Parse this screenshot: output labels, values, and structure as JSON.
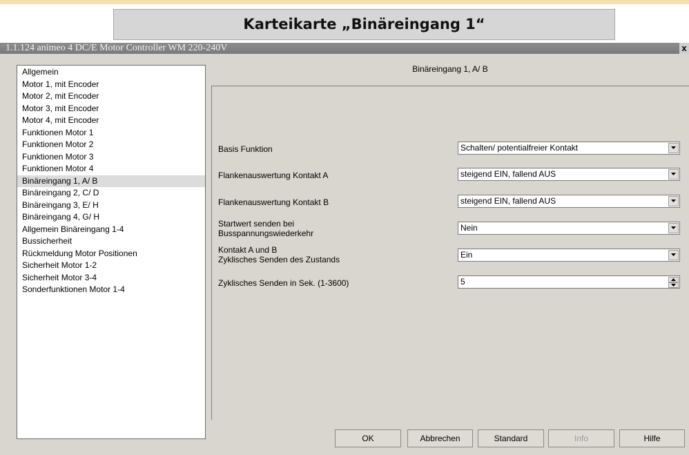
{
  "caption": "Karteikarte „Binäreingang 1“",
  "window": {
    "title": "1.1.124 animeo 4 DC/E Motor Controller WM 220-240V",
    "close_glyph": "x"
  },
  "tree": {
    "items": [
      "Allgemein",
      "Motor 1, mit Encoder",
      "Motor 2, mit Encoder",
      "Motor 3, mit Encoder",
      "Motor 4, mit Encoder",
      "Funktionen Motor 1",
      "Funktionen Motor 2",
      "Funktionen Motor 3",
      "Funktionen Motor 4",
      "Binäreingang 1, A/ B",
      "Binäreingang 2, C/ D",
      "Binäreingang 3, E/ H",
      "Binäreingang 4, G/ H",
      "Allgemein Binäreingang 1-4",
      "Bussicherheit",
      "Rückmeldung Motor Positionen",
      "Sicherheit Motor 1-2",
      "Sicherheit Motor 3-4",
      "Sonderfunktionen Motor 1-4"
    ],
    "selected_index": 9
  },
  "panel": {
    "title": "Binäreingang 1, A/ B",
    "params": [
      {
        "label": "Basis Funktion",
        "value": "Schalten/ potentialfreier Kontakt"
      },
      {
        "label": "Flankenauswertung Kontakt A",
        "value": "steigend EIN, fallend AUS"
      },
      {
        "label": "Flankenauswertung Kontakt B",
        "value": "steigend EIN, fallend AUS"
      },
      {
        "label_line1": "Startwert senden bei",
        "label_line2": "Busspannungswiederkehr",
        "value": "Nein"
      },
      {
        "label_line1": "Kontakt A und B",
        "label_line2": "Zyklisches Senden des Zustands",
        "value": "Ein"
      },
      {
        "label": "Zyklisches Senden in Sek. (1-3600)",
        "value": "5"
      }
    ]
  },
  "buttons": {
    "ok": "OK",
    "cancel": "Abbrechen",
    "standard": "Standard",
    "info": "Info",
    "help": "Hilfe"
  },
  "colors": {
    "window_bg": "#d9d5cf",
    "selection": "#dcdcdc",
    "banner_strip": "#f6ddb0"
  }
}
